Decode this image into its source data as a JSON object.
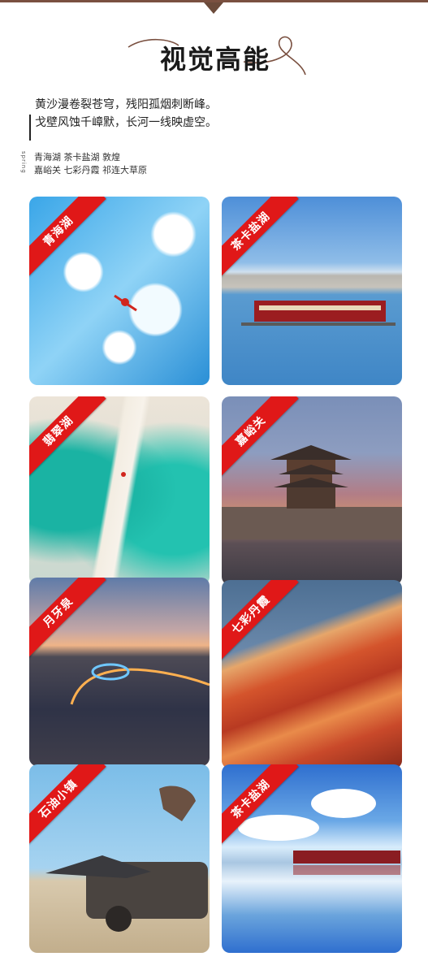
{
  "header": {
    "title": "视觉高能"
  },
  "intro": {
    "poem": [
      "黄沙漫卷裂苍穹，残阳孤烟刺断峰。",
      "戈壁风蚀千嶂默，长河一线映虚空。"
    ],
    "side_label": "spring",
    "places": [
      "青海湖 茶卡盐湖 敦煌",
      "嘉峪关 七彩丹霞 祁连大草原"
    ]
  },
  "gallery": {
    "cards": [
      {
        "label": "青海湖",
        "scene": "frozen-lake-aerial"
      },
      {
        "label": "茶卡盐湖",
        "scene": "salt-lake-train"
      },
      {
        "label": "翡翠湖",
        "scene": "emerald-lake-aerial"
      },
      {
        "label": "嘉峪关",
        "scene": "fortress-tower"
      },
      {
        "label": "月牙泉",
        "scene": "crescent-spring-dunes"
      },
      {
        "label": "七彩丹霞",
        "scene": "rainbow-mountains"
      },
      {
        "label": "石油小镇",
        "scene": "abandoned-car-town"
      },
      {
        "label": "茶卡盐湖",
        "scene": "mirror-lake-train"
      }
    ]
  },
  "colors": {
    "ribbon": "#e01818",
    "accent_brown": "#7a5040"
  }
}
